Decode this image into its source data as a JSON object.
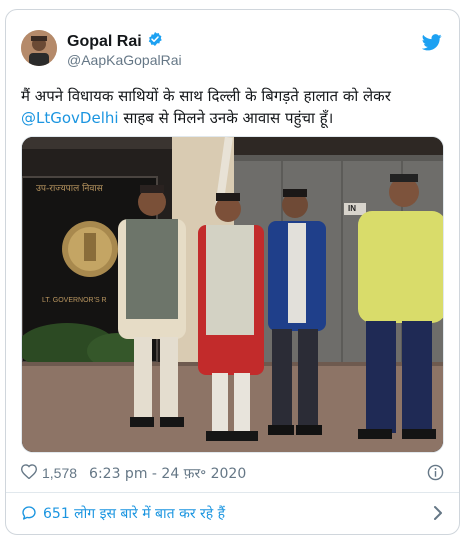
{
  "author": {
    "name": "Gopal Rai",
    "handle": "@AapKaGopalRai",
    "verified": true
  },
  "tweet": {
    "text_before": "मैं अपने विधायक साथियों के साथ दिल्ली के बिगड़ते हालात को लेकर",
    "mention": "@LtGovDelhi",
    "text_after": " साहब से मिलने उनके आवास पहुंचा हूँ।"
  },
  "photo": {
    "sign_text": "उप-राज्यपाल निवास",
    "sign_text_en": "LT. GOVERNOR'S R",
    "badge_text": "IN"
  },
  "meta": {
    "likes": "1,578",
    "timestamp": "6:23 pm - 24 फ़र॰ 2020"
  },
  "footer": {
    "conversation": "651 लोग इस बारे में बात कर रहे हैं"
  },
  "colors": {
    "accent": "#1b95e0",
    "muted": "#657786",
    "border": "#e1e8ed"
  },
  "icons": [
    "twitter-bird-icon",
    "verified-badge-icon",
    "heart-icon",
    "info-icon",
    "reply-bubble-icon",
    "chevron-right-icon"
  ]
}
